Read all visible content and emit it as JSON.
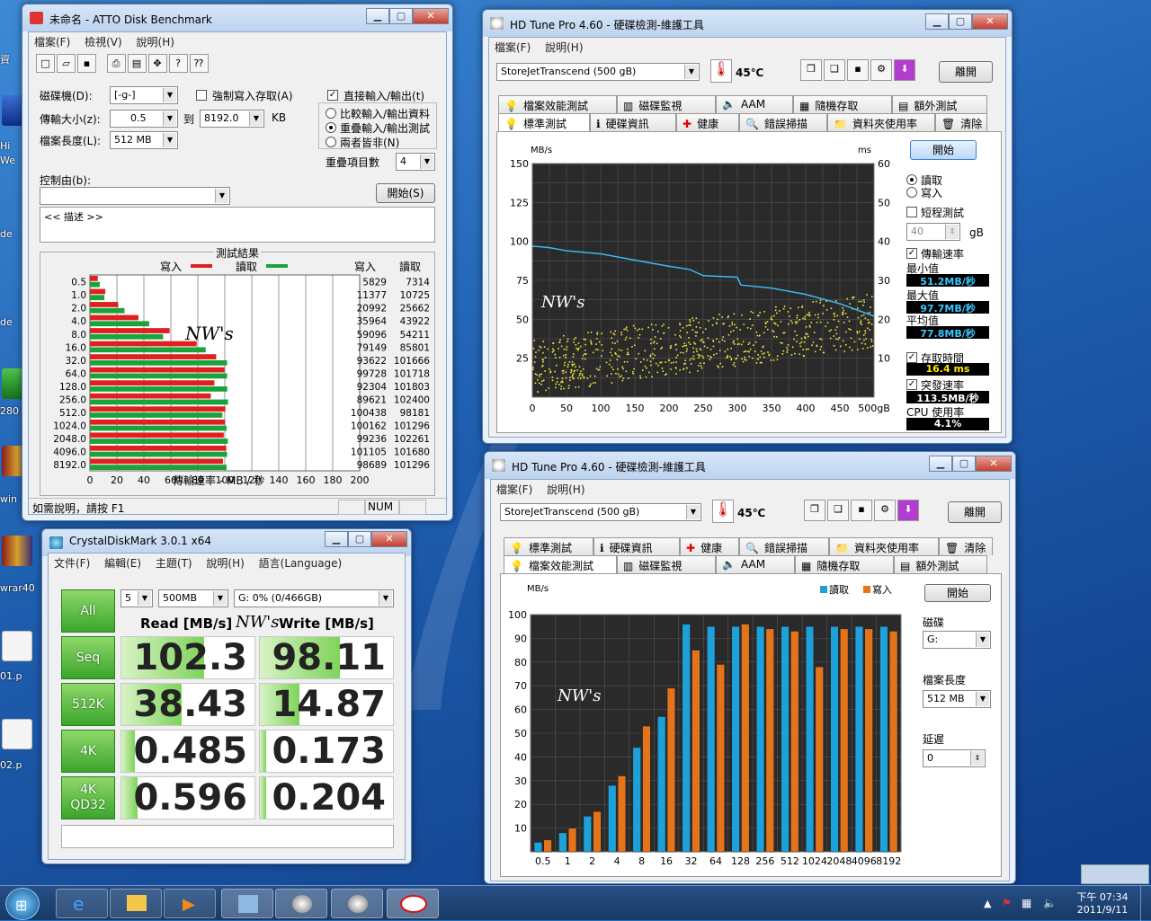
{
  "desktop": {
    "labels": [
      "資",
      "Hi",
      "We",
      "de",
      "de",
      "280",
      "win",
      "wrar40",
      "01.p",
      "02.p"
    ]
  },
  "atto": {
    "title": "未命名 - ATTO Disk Benchmark",
    "menu": [
      "檔案(F)",
      "檢視(V)",
      "說明(H)"
    ],
    "drive_label": "磁碟機(D):",
    "drive_value": "[-g-]",
    "force_write_label": "強制寫入存取(A)",
    "direct_io_label": "直接輸入/輸出(t)",
    "transfer_size_label": "傳輸大小(z):",
    "transfer_from": "0.5",
    "to_label": "到",
    "transfer_to": "8192.0",
    "kb": "KB",
    "compare_label": "比較輸入/輸出資料",
    "overlap_label": "重疊輸入/輸出測試",
    "neither_label": "兩者皆非(N)",
    "file_length_label": "檔案長度(L):",
    "file_length_value": "512 MB",
    "queue_label": "重疊項目數",
    "queue_value": "4",
    "controlled_label": "控制由(b):",
    "start_label": "開始(S)",
    "desc": "<<   描述   >>",
    "results_title": "測試結果",
    "legend_write": "寫入",
    "legend_read": "讀取",
    "col_write": "寫入",
    "col_read": "讀取",
    "watermark": "NW's",
    "xlabel": "傳輸速率 - MB / 秒",
    "status": "如需說明，請按 F1",
    "status_num": "NUM"
  },
  "hdtune1": {
    "title": "HD Tune Pro 4.60 - 硬碟檢測-維護工具",
    "menu": [
      "檔案(F)",
      "說明(H)"
    ],
    "drive": "StoreJetTranscend        (500 gB)",
    "temp": "45℃",
    "exit": "離開",
    "tabs_top": [
      "檔案效能測試",
      "磁碟監視",
      "AAM",
      "隨機存取",
      "額外測試"
    ],
    "tabs_bottom": [
      "標準測試",
      "硬碟資訊",
      "健康",
      "錯誤掃描",
      "資料夾使用率",
      "清除"
    ],
    "start": "開始",
    "read": "讀取",
    "write": "寫入",
    "short_test": "短程測試",
    "short_value": "40",
    "gb": "gB",
    "transfer_rate": "傳輸速率",
    "min_label": "最小值",
    "min_value": "51.2MB/秒",
    "max_label": "最大值",
    "max_value": "97.7MB/秒",
    "avg_label": "平均值",
    "avg_value": "77.8MB/秒",
    "access_label": "存取時間",
    "access_value": "16.4 ms",
    "burst_label": "突發速率",
    "burst_value": "113.5MB/秒",
    "cpu_label": "CPU 使用率",
    "cpu_value": "4.1%",
    "unit_left": "MB/s",
    "unit_right": "ms",
    "watermark": "NW's"
  },
  "hdtune2": {
    "title": "HD Tune Pro 4.60 - 硬碟檢測-維護工具",
    "menu": [
      "檔案(F)",
      "說明(H)"
    ],
    "drive": "StoreJetTranscend        (500 gB)",
    "temp": "45℃",
    "exit": "離開",
    "tabs_top": [
      "標準測試",
      "硬碟資訊",
      "健康",
      "錯誤掃描",
      "資料夾使用率",
      "清除"
    ],
    "tabs_bottom": [
      "檔案效能測試",
      "磁碟監視",
      "AAM",
      "隨機存取",
      "額外測試"
    ],
    "start": "開始",
    "disk_label": "磁碟",
    "disk_value": "G:",
    "file_length_label": "檔案長度",
    "file_length_value": "512 MB",
    "delay_label": "延遲",
    "delay_value": "0",
    "unit": "MB/s",
    "legend_read": "讀取",
    "legend_write": "寫入",
    "watermark": "NW's"
  },
  "cdm": {
    "title": "CrystalDiskMark 3.0.1 x64",
    "menu": [
      "文件(F)",
      "編輯(E)",
      "主題(T)",
      "說明(H)",
      "語言(Language)"
    ],
    "all": "All",
    "count": "5",
    "size": "500MB",
    "drive": "G: 0% (0/466GB)",
    "read_header": "Read [MB/s]",
    "write_header": "Write [MB/s]",
    "watermark": "NW's",
    "rows": [
      {
        "label": "Seq",
        "read": "102.3",
        "write": "98.11",
        "read_fill": 0.62,
        "write_fill": 0.6
      },
      {
        "label": "512K",
        "read": "38.43",
        "write": "14.87",
        "read_fill": 0.45,
        "write_fill": 0.3
      },
      {
        "label": "4K",
        "read": "0.485",
        "write": "0.173",
        "read_fill": 0.1,
        "write_fill": 0.05
      },
      {
        "label": "4K\nQD32",
        "read": "0.596",
        "write": "0.204",
        "read_fill": 0.12,
        "write_fill": 0.05
      }
    ]
  },
  "taskbar": {
    "time": "下午 07:34",
    "date": "2011/9/11"
  },
  "chart_data": [
    {
      "type": "bar",
      "id": "atto",
      "title": "測試結果",
      "xlabel": "傳輸速率 - MB / 秒",
      "xlim": [
        0,
        200
      ],
      "xticks": [
        "0",
        "20",
        "40",
        "60",
        "80",
        "100",
        "120",
        "140",
        "160",
        "180",
        "200"
      ],
      "categories": [
        "0.5",
        "1.0",
        "2.0",
        "4.0",
        "8.0",
        "16.0",
        "32.0",
        "64.0",
        "128.0",
        "256.0",
        "512.0",
        "1024.0",
        "2048.0",
        "4096.0",
        "8192.0"
      ],
      "series": [
        {
          "name": "寫入",
          "color": "#e02020",
          "values": [
            5829,
            11377,
            20992,
            35964,
            59096,
            79149,
            93622,
            99728,
            92304,
            89621,
            100438,
            100162,
            99236,
            101105,
            98689
          ]
        },
        {
          "name": "讀取",
          "color": "#1aa33a",
          "values": [
            7314,
            10725,
            25662,
            43922,
            54211,
            85801,
            101666,
            101718,
            101803,
            102400,
            98181,
            101296,
            102261,
            101680,
            101296
          ]
        }
      ]
    },
    {
      "type": "line",
      "id": "hdtune_standard",
      "xlim": [
        0,
        500
      ],
      "xticks": [
        "0",
        "50",
        "100",
        "150",
        "200",
        "250",
        "300",
        "350",
        "400",
        "450",
        "500gB"
      ],
      "ylim": [
        0,
        150
      ],
      "yticks": [
        "25",
        "50",
        "75",
        "100",
        "125",
        "150"
      ],
      "y2lim": [
        0,
        60
      ],
      "y2ticks": [
        "10",
        "20",
        "30",
        "40",
        "50",
        "60"
      ],
      "series": [
        {
          "name": "transfer",
          "color": "#3db8f0",
          "x": [
            0,
            25,
            50,
            100,
            150,
            200,
            230,
            250,
            300,
            305,
            350,
            400,
            450,
            500
          ],
          "y": [
            97,
            96,
            94,
            92,
            88,
            84,
            82,
            78,
            77,
            72,
            70,
            66,
            60,
            52
          ]
        }
      ]
    },
    {
      "type": "bar",
      "id": "hdtune_file",
      "ylim": [
        0,
        100
      ],
      "yticks": [
        "10",
        "20",
        "30",
        "40",
        "50",
        "60",
        "70",
        "80",
        "90",
        "100"
      ],
      "categories": [
        "0.5",
        "1",
        "2",
        "4",
        "8",
        "16",
        "32",
        "64",
        "128",
        "256",
        "512",
        "1024",
        "2048",
        "4096",
        "8192"
      ],
      "series": [
        {
          "name": "讀取",
          "color": "#1ea0d8",
          "values": [
            4,
            8,
            15,
            28,
            44,
            57,
            96,
            95,
            95,
            95,
            95,
            95,
            95,
            95,
            95
          ]
        },
        {
          "name": "寫入",
          "color": "#e3741c",
          "values": [
            5,
            10,
            17,
            32,
            53,
            69,
            85,
            79,
            96,
            94,
            93,
            78,
            94,
            94,
            93
          ]
        }
      ]
    }
  ]
}
